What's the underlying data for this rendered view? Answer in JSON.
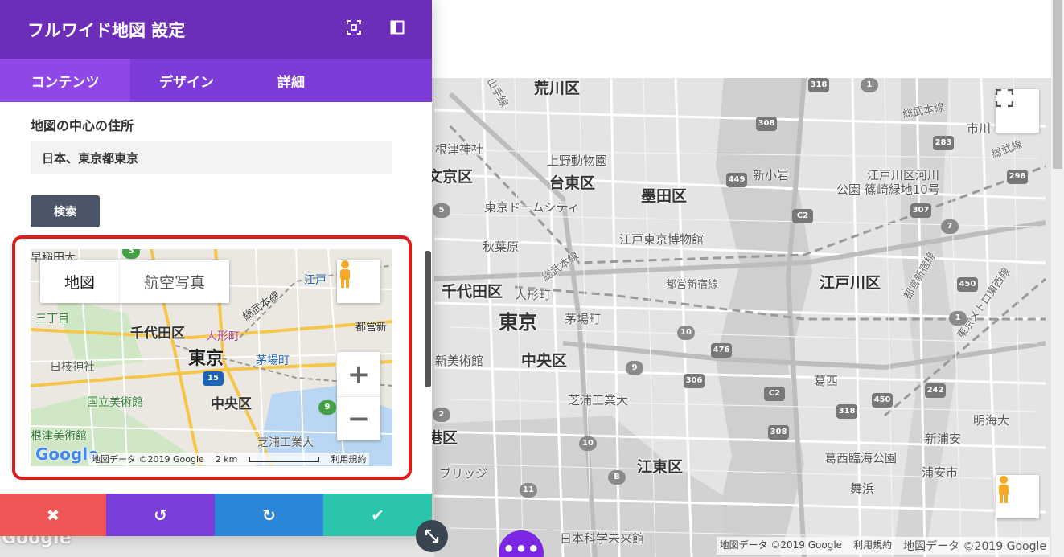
{
  "panel": {
    "title": "フルワイド地図 設定",
    "tabs": [
      {
        "label": "コンテンツ"
      },
      {
        "label": "デザイン"
      },
      {
        "label": "詳細"
      }
    ],
    "address_label": "地図の中心の住所",
    "address_value": "日本、東京都東京",
    "search_label": "検索",
    "footer": {
      "cancel_icon": "✖",
      "undo_icon": "↺",
      "redo_icon": "↻",
      "save_icon": "✔"
    }
  },
  "minimap": {
    "map_type": [
      "地図",
      "航空写真"
    ],
    "labels": [
      "早稲田大",
      "三丁目",
      "千代田区",
      "人形町",
      "東京",
      "茅場町",
      "日枝神社",
      "国立美術館",
      "中央区",
      "芝浦工業大",
      "根津美術館",
      "都営新",
      "総武本線",
      "江戸"
    ],
    "shields": [
      "5",
      "15",
      "9"
    ],
    "zoom_in": "+",
    "zoom_out": "−",
    "logo": "Google",
    "attribution": "地図データ ©2019 Google",
    "scale": "2 km",
    "terms": "利用規約"
  },
  "bigmap": {
    "labels_big": [
      "荒川区",
      "台東区",
      "墨田区",
      "文京区",
      "千代田区",
      "東京",
      "中央区",
      "江戸川区",
      "江東区",
      "港区"
    ],
    "labels_mid": [
      "上野動物園",
      "東京ドームシティ",
      "秋葉原",
      "江戸東京博物館",
      "人形町",
      "茅場町",
      "新美術館",
      "芝浦工業大",
      "新小岩",
      "江戸川区河川",
      "公園 篠崎緑地10号",
      "葛西",
      "葛西臨海公園",
      "舞浜",
      "浦安市",
      "新浦安",
      "明海大",
      "日本科学未来館",
      "ブリッジ",
      "根津神社",
      "市川"
    ],
    "labels_road": [
      "総武本線",
      "都営新宿線",
      "総武線",
      "都営新宿線",
      "東京メトロ東西線",
      "総武本線",
      "山手線"
    ],
    "shields": [
      "318",
      "308",
      "449",
      "5",
      "C2",
      "283",
      "298",
      "307",
      "7",
      "450",
      "10",
      "476",
      "306",
      "9",
      "C2",
      "242",
      "318",
      "450",
      "308",
      "10",
      "11",
      "B",
      "1",
      "2",
      "1"
    ],
    "attribution_small": "地図データ ©2019 Google",
    "terms": "利用規約",
    "attribution_big": "地図データ ©2019 Google",
    "logo": "Google"
  },
  "overlay": {
    "dots": "•••"
  },
  "colors": {
    "header": "#6c2eb9",
    "tabs": "#7d3cd7",
    "tab_active": "#8f47e6",
    "cancel": "#ef5555",
    "undo": "#7b3fd9",
    "redo": "#2b87da",
    "save": "#29c4a9",
    "highlight": "#e01b1b"
  }
}
